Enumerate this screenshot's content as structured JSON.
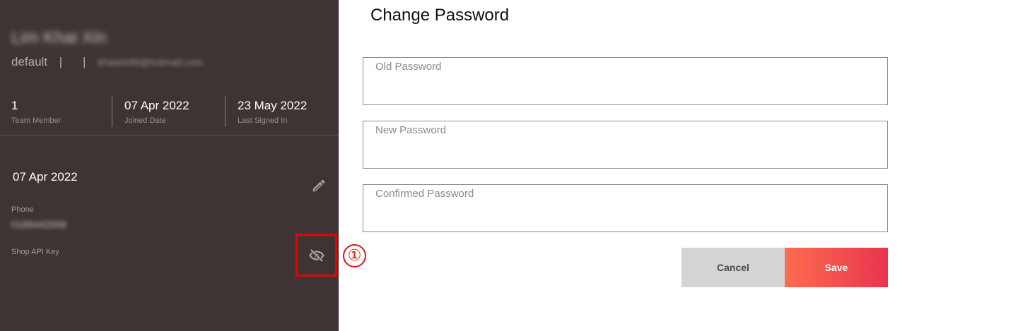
{
  "profile": {
    "name": "Lim Khai Xin",
    "role": "default",
    "separator": "|",
    "email": "khaixin96@hotmail.com"
  },
  "stats": [
    {
      "value": "1",
      "label": "Team Member"
    },
    {
      "value": "07 Apr 2022",
      "label": "Joined Date"
    },
    {
      "value": "23 May 2022",
      "label": "Last Signed In"
    }
  ],
  "details": {
    "date": "07 Apr 2022",
    "phone_label": "Phone",
    "phone_value": "0189442008",
    "api_key_label": "Shop API Key"
  },
  "annotation": {
    "marker": "①"
  },
  "change_password": {
    "title": "Change Password",
    "old_placeholder": "Old Password",
    "new_placeholder": "New Password",
    "confirm_placeholder": "Confirmed Password",
    "cancel_label": "Cancel",
    "save_label": "Save"
  },
  "icons": {
    "edit": "pencil-icon",
    "visibility": "eye-off-icon"
  },
  "colors": {
    "sidebar_bg": "#3e3434",
    "save_gradient_start": "#fc6c4f",
    "save_gradient_end": "#e8354f",
    "cancel_bg": "#d4d4d4",
    "highlight": "#ee0000"
  }
}
